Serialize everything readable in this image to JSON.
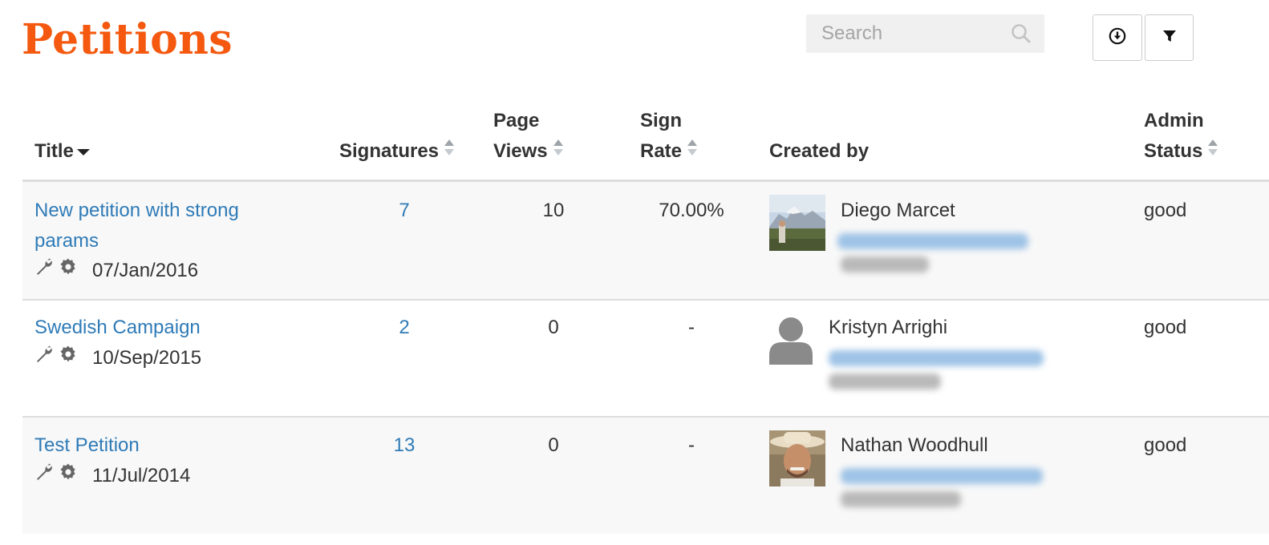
{
  "page": {
    "title": "Petitions"
  },
  "search": {
    "placeholder": "Search",
    "value": ""
  },
  "toolbar": {
    "download_icon": "download-circle-icon",
    "filter_icon": "filter-icon"
  },
  "table": {
    "headers": {
      "title": "Title",
      "signatures": "Signatures",
      "page_views_1": "Page",
      "page_views_2": "Views",
      "sign_rate_1": "Sign",
      "sign_rate_2": "Rate",
      "created_by": "Created by",
      "admin_status_1": "Admin",
      "admin_status_2": "Status"
    },
    "rows": [
      {
        "title": "New petition with strong params",
        "date": "07/Jan/2016",
        "signatures": "7",
        "page_views": "10",
        "sign_rate": "70.00%",
        "creator": "Diego Marcet",
        "avatar": "photo-landscape",
        "status": "good"
      },
      {
        "title": "Swedish Campaign",
        "date": "10/Sep/2015",
        "signatures": "2",
        "page_views": "0",
        "sign_rate": "-",
        "creator": "Kristyn Arrighi",
        "avatar": "default-person",
        "status": "good"
      },
      {
        "title": "Test Petition",
        "date": "11/Jul/2014",
        "signatures": "13",
        "page_views": "0",
        "sign_rate": "-",
        "creator": "Nathan Woodhull",
        "avatar": "photo-portrait",
        "status": "good"
      }
    ]
  },
  "colors": {
    "brand": "#f4590f",
    "link": "#2f7bb7",
    "row_alt": "#f8f8f8"
  }
}
